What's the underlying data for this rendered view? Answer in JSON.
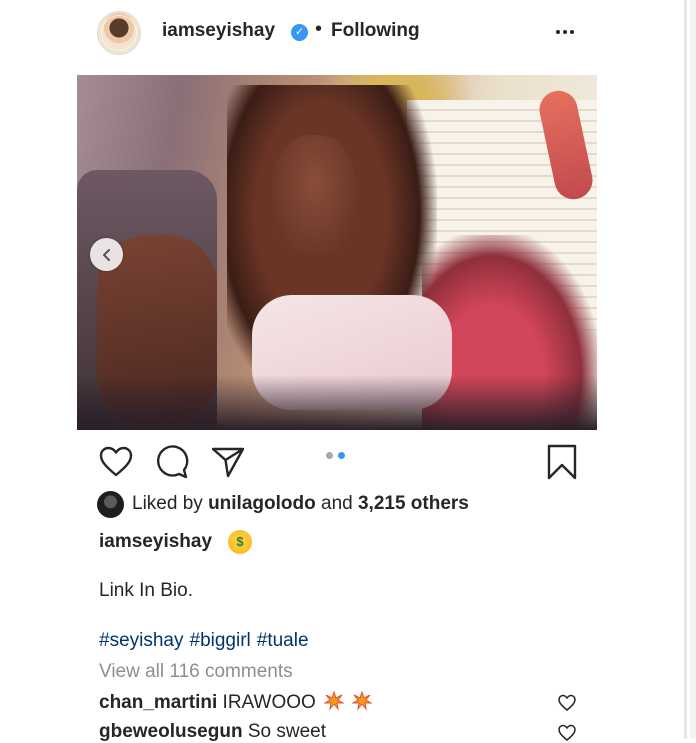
{
  "header": {
    "username": "iamseyishay",
    "verified_icon": "verified-badge-icon",
    "separator": "•",
    "following_label": "Following",
    "more_icon": "more-options-icon"
  },
  "post": {
    "carousel_prev_icon": "chevron-left-icon",
    "carousel_dots": {
      "count": 2,
      "active_index": 1
    }
  },
  "actions": {
    "like_icon": "heart-icon",
    "comment_icon": "comment-bubble-icon",
    "share_icon": "paper-plane-icon",
    "save_icon": "bookmark-icon"
  },
  "likes": {
    "prefix": "Liked by",
    "user": "unilagolodo",
    "conjunction": "and",
    "others": "3,215 others"
  },
  "caption": {
    "username": "iamseyishay",
    "emoji": "money-mouth-face-emoji",
    "line": "Link In Bio.",
    "hashtags": [
      "#seyishay",
      "#biggirl",
      "#tuale"
    ]
  },
  "comments": {
    "view_all_label": "View all 116 comments",
    "items": [
      {
        "username": "chan_martini",
        "text": "IRAWOOO",
        "emojis": [
          "collision-emoji",
          "collision-emoji"
        ]
      },
      {
        "username": "gbeweolusegun",
        "text": "So sweet",
        "emojis": []
      }
    ]
  },
  "colors": {
    "text": "#262626",
    "muted": "#8e8e8e",
    "hashtag": "#003569",
    "verified": "#3897f0",
    "dot_active": "#3897f0",
    "dot_inactive": "#a8a8a8"
  }
}
